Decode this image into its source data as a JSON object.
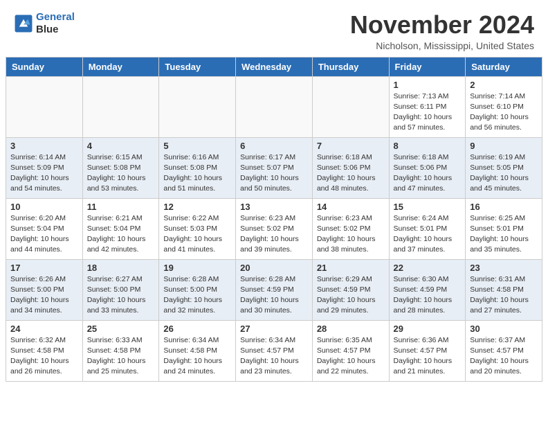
{
  "header": {
    "logo_line1": "General",
    "logo_line2": "Blue",
    "month_title": "November 2024",
    "location": "Nicholson, Mississippi, United States"
  },
  "calendar": {
    "day_headers": [
      "Sunday",
      "Monday",
      "Tuesday",
      "Wednesday",
      "Thursday",
      "Friday",
      "Saturday"
    ],
    "weeks": [
      [
        {
          "day": "",
          "info": ""
        },
        {
          "day": "",
          "info": ""
        },
        {
          "day": "",
          "info": ""
        },
        {
          "day": "",
          "info": ""
        },
        {
          "day": "",
          "info": ""
        },
        {
          "day": "1",
          "info": "Sunrise: 7:13 AM\nSunset: 6:11 PM\nDaylight: 10 hours\nand 57 minutes."
        },
        {
          "day": "2",
          "info": "Sunrise: 7:14 AM\nSunset: 6:10 PM\nDaylight: 10 hours\nand 56 minutes."
        }
      ],
      [
        {
          "day": "3",
          "info": "Sunrise: 6:14 AM\nSunset: 5:09 PM\nDaylight: 10 hours\nand 54 minutes."
        },
        {
          "day": "4",
          "info": "Sunrise: 6:15 AM\nSunset: 5:08 PM\nDaylight: 10 hours\nand 53 minutes."
        },
        {
          "day": "5",
          "info": "Sunrise: 6:16 AM\nSunset: 5:08 PM\nDaylight: 10 hours\nand 51 minutes."
        },
        {
          "day": "6",
          "info": "Sunrise: 6:17 AM\nSunset: 5:07 PM\nDaylight: 10 hours\nand 50 minutes."
        },
        {
          "day": "7",
          "info": "Sunrise: 6:18 AM\nSunset: 5:06 PM\nDaylight: 10 hours\nand 48 minutes."
        },
        {
          "day": "8",
          "info": "Sunrise: 6:18 AM\nSunset: 5:06 PM\nDaylight: 10 hours\nand 47 minutes."
        },
        {
          "day": "9",
          "info": "Sunrise: 6:19 AM\nSunset: 5:05 PM\nDaylight: 10 hours\nand 45 minutes."
        }
      ],
      [
        {
          "day": "10",
          "info": "Sunrise: 6:20 AM\nSunset: 5:04 PM\nDaylight: 10 hours\nand 44 minutes."
        },
        {
          "day": "11",
          "info": "Sunrise: 6:21 AM\nSunset: 5:04 PM\nDaylight: 10 hours\nand 42 minutes."
        },
        {
          "day": "12",
          "info": "Sunrise: 6:22 AM\nSunset: 5:03 PM\nDaylight: 10 hours\nand 41 minutes."
        },
        {
          "day": "13",
          "info": "Sunrise: 6:23 AM\nSunset: 5:02 PM\nDaylight: 10 hours\nand 39 minutes."
        },
        {
          "day": "14",
          "info": "Sunrise: 6:23 AM\nSunset: 5:02 PM\nDaylight: 10 hours\nand 38 minutes."
        },
        {
          "day": "15",
          "info": "Sunrise: 6:24 AM\nSunset: 5:01 PM\nDaylight: 10 hours\nand 37 minutes."
        },
        {
          "day": "16",
          "info": "Sunrise: 6:25 AM\nSunset: 5:01 PM\nDaylight: 10 hours\nand 35 minutes."
        }
      ],
      [
        {
          "day": "17",
          "info": "Sunrise: 6:26 AM\nSunset: 5:00 PM\nDaylight: 10 hours\nand 34 minutes."
        },
        {
          "day": "18",
          "info": "Sunrise: 6:27 AM\nSunset: 5:00 PM\nDaylight: 10 hours\nand 33 minutes."
        },
        {
          "day": "19",
          "info": "Sunrise: 6:28 AM\nSunset: 5:00 PM\nDaylight: 10 hours\nand 32 minutes."
        },
        {
          "day": "20",
          "info": "Sunrise: 6:28 AM\nSunset: 4:59 PM\nDaylight: 10 hours\nand 30 minutes."
        },
        {
          "day": "21",
          "info": "Sunrise: 6:29 AM\nSunset: 4:59 PM\nDaylight: 10 hours\nand 29 minutes."
        },
        {
          "day": "22",
          "info": "Sunrise: 6:30 AM\nSunset: 4:59 PM\nDaylight: 10 hours\nand 28 minutes."
        },
        {
          "day": "23",
          "info": "Sunrise: 6:31 AM\nSunset: 4:58 PM\nDaylight: 10 hours\nand 27 minutes."
        }
      ],
      [
        {
          "day": "24",
          "info": "Sunrise: 6:32 AM\nSunset: 4:58 PM\nDaylight: 10 hours\nand 26 minutes."
        },
        {
          "day": "25",
          "info": "Sunrise: 6:33 AM\nSunset: 4:58 PM\nDaylight: 10 hours\nand 25 minutes."
        },
        {
          "day": "26",
          "info": "Sunrise: 6:34 AM\nSunset: 4:58 PM\nDaylight: 10 hours\nand 24 minutes."
        },
        {
          "day": "27",
          "info": "Sunrise: 6:34 AM\nSunset: 4:57 PM\nDaylight: 10 hours\nand 23 minutes."
        },
        {
          "day": "28",
          "info": "Sunrise: 6:35 AM\nSunset: 4:57 PM\nDaylight: 10 hours\nand 22 minutes."
        },
        {
          "day": "29",
          "info": "Sunrise: 6:36 AM\nSunset: 4:57 PM\nDaylight: 10 hours\nand 21 minutes."
        },
        {
          "day": "30",
          "info": "Sunrise: 6:37 AM\nSunset: 4:57 PM\nDaylight: 10 hours\nand 20 minutes."
        }
      ]
    ]
  }
}
